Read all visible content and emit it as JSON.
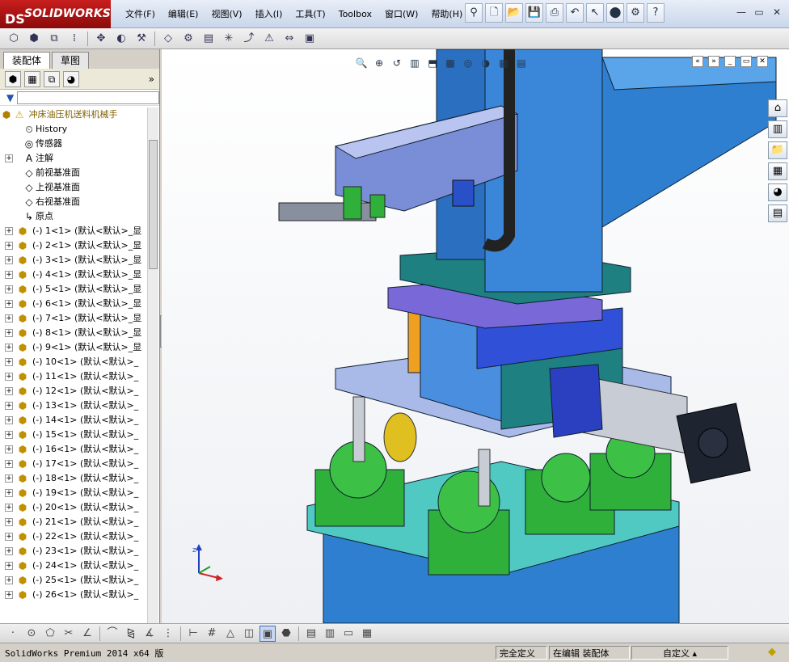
{
  "app": {
    "name": "SOLIDWORKS",
    "logo_prefix": "DS"
  },
  "menu": [
    "文件(F)",
    "编辑(E)",
    "视图(V)",
    "插入(I)",
    "工具(T)",
    "Toolbox",
    "窗口(W)",
    "帮助(H)"
  ],
  "quick_access": [
    "pushpin-icon",
    "new-document-icon",
    "open-icon",
    "save-icon",
    "print-icon",
    "undo-icon",
    "select-icon",
    "rebuild-icon",
    "options-icon",
    "help-icon"
  ],
  "window_controls": [
    "minimize-icon",
    "restore-icon",
    "close-icon"
  ],
  "feature_manager": {
    "tabs": [
      "装配体",
      "草图"
    ],
    "active_tab": "装配体",
    "root": "冲床油压机送料机械手",
    "fixed_nodes": [
      {
        "label": "History",
        "icon": "history-icon",
        "expandable": false
      },
      {
        "label": "传感器",
        "icon": "sensor-icon",
        "expandable": false
      },
      {
        "label": "注解",
        "icon": "annotation-icon",
        "expandable": true
      },
      {
        "label": "前视基准面",
        "icon": "plane-icon",
        "expandable": false
      },
      {
        "label": "上视基准面",
        "icon": "plane-icon",
        "expandable": false
      },
      {
        "label": "右视基准面",
        "icon": "plane-icon",
        "expandable": false
      },
      {
        "label": "原点",
        "icon": "origin-icon",
        "expandable": false
      }
    ],
    "components": [
      "(-) 1<1> (默认<默认>_显",
      "(-) 2<1> (默认<默认>_显",
      "(-) 3<1> (默认<默认>_显",
      "(-) 4<1> (默认<默认>_显",
      "(-) 5<1> (默认<默认>_显",
      "(-) 6<1> (默认<默认>_显",
      "(-) 7<1> (默认<默认>_显",
      "(-) 8<1> (默认<默认>_显",
      "(-) 9<1> (默认<默认>_显",
      "(-) 10<1> (默认<默认>_",
      "(-) 11<1> (默认<默认>_",
      "(-) 12<1> (默认<默认>_",
      "(-) 13<1> (默认<默认>_",
      "(-) 14<1> (默认<默认>_",
      "(-) 15<1> (默认<默认>_",
      "(-) 16<1> (默认<默认>_",
      "(-) 17<1> (默认<默认>_",
      "(-) 18<1> (默认<默认>_",
      "(-) 19<1> (默认<默认>_",
      "(-) 20<1> (默认<默认>_",
      "(-) 21<1> (默认<默认>_",
      "(-) 22<1> (默认<默认>_",
      "(-) 23<1> (默认<默认>_",
      "(-) 24<1> (默认<默认>_",
      "(-) 25<1> (默认<默认>_",
      "(-) 26<1> (默认<默认>_"
    ]
  },
  "status": {
    "product": "SolidWorks Premium 2014 x64 版",
    "definition": "完全定义",
    "editing": "在编辑 装配体",
    "custom": "自定义"
  },
  "colors": {
    "logo_red": "#b01414",
    "model_blue": "#2e7fd0",
    "model_green": "#2fb03a",
    "model_teal": "#4fc9c2",
    "model_purple": "#7868d8",
    "model_orange": "#f0a020"
  }
}
